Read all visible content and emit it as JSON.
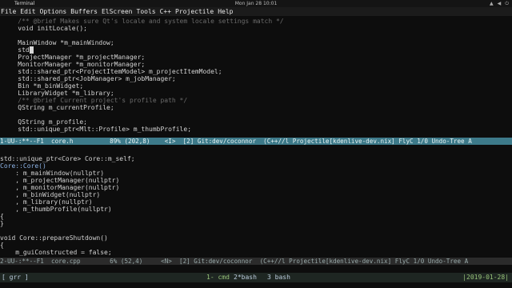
{
  "window": {
    "title": "Terminal",
    "clock": "Mon Jan 28  10:01"
  },
  "menu": [
    "File",
    "Edit",
    "Options",
    "Buffers",
    "ElScreen",
    "Tools",
    "C++",
    "Projectile",
    "Help"
  ],
  "pane1": {
    "lines": [
      {
        "text": "    /** @brief Makes sure Qt's locale and system locale settings match */",
        "cls": "c-comment"
      },
      {
        "text": "    void initLocale();",
        "cls": "c-plain"
      },
      {
        "text": "",
        "cls": "c-plain"
      },
      {
        "text": "    MainWindow *m_mainWindow;",
        "cls": "c-plain"
      },
      {
        "text": "    std",
        "cls": "c-plain",
        "cursor": true
      },
      {
        "text": "    ProjectManager *m_projectManager;",
        "cls": "c-plain"
      },
      {
        "text": "    MonitorManager *m_monitorManager;",
        "cls": "c-plain"
      },
      {
        "text": "    std::shared_ptr<ProjectItemModel> m_projectItemModel;",
        "cls": "c-plain"
      },
      {
        "text": "    std::shared_ptr<JobManager> m_jobManager;",
        "cls": "c-plain"
      },
      {
        "text": "    Bin *m_binWidget;",
        "cls": "c-plain"
      },
      {
        "text": "    LibraryWidget *m_library;",
        "cls": "c-plain"
      },
      {
        "text": "    /** @brief Current project's profile path */",
        "cls": "c-comment"
      },
      {
        "text": "    QString m_currentProfile;",
        "cls": "c-plain"
      },
      {
        "text": "",
        "cls": "c-plain"
      },
      {
        "text": "    QString m_profile;",
        "cls": "c-plain"
      },
      {
        "text": "    std::unique_ptr<Mlt::Profile> m_thumbProfile;",
        "cls": "c-plain"
      }
    ]
  },
  "modeline1": "1-UU-:**--F1  core.h          89% (202,8)    <I>  [2] Git:dev/coconnor  (C++//l Projectile[kdenlive-dev.nix] FlyC 1/0 Undo-Tree A",
  "pane2": {
    "lines": [
      {
        "text": "",
        "cls": "c-plain"
      },
      {
        "text": "std::unique_ptr<Core> Core::m_self;",
        "cls": "c-plain"
      },
      {
        "text": "Core::Core()",
        "cls": "c-func"
      },
      {
        "text": "    : m_mainWindow(nullptr)",
        "cls": "c-plain"
      },
      {
        "text": "    , m_projectManager(nullptr)",
        "cls": "c-plain"
      },
      {
        "text": "    , m_monitorManager(nullptr)",
        "cls": "c-plain"
      },
      {
        "text": "    , m_binWidget(nullptr)",
        "cls": "c-plain"
      },
      {
        "text": "    , m_library(nullptr)",
        "cls": "c-plain"
      },
      {
        "text": "    , m_thumbProfile(nullptr)",
        "cls": "c-plain"
      },
      {
        "text": "{",
        "cls": "c-plain"
      },
      {
        "text": "}",
        "cls": "c-plain"
      },
      {
        "text": "",
        "cls": "c-plain"
      },
      {
        "text": "void Core::prepareShutdown()",
        "cls": "c-plain"
      },
      {
        "text": "{",
        "cls": "c-plain"
      },
      {
        "text": "    m_guiConstructed = false;",
        "cls": "c-plain"
      },
      {
        "text": "}",
        "cls": "c-plain"
      }
    ]
  },
  "modeline2": "2-UU-:**--F1  core.cpp        6% (52,4)     <N>  [2] Git:dev/coconnor  (C++//l Projectile[kdenlive-dev.nix] FlyC 1/0 Undo-Tree A",
  "tmux": {
    "session": "[ grr ]",
    "windows": [
      {
        "label": "1- cmd",
        "active": true
      },
      {
        "label": "2*bash",
        "active": false
      },
      {
        "label": "3 bash",
        "active": false
      }
    ],
    "date": "|2019-01-28|"
  }
}
